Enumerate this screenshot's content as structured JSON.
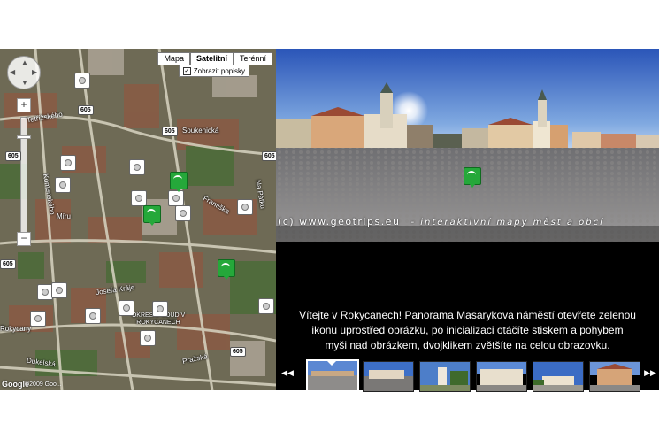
{
  "map": {
    "types": [
      "Mapa",
      "Satelitní",
      "Terénní"
    ],
    "active_type": "Satelitní",
    "labels_checkbox": "Zobrazit popisky",
    "labels_checked": true,
    "roads": [
      "605",
      "605",
      "605",
      "605",
      "605",
      "605"
    ],
    "streets": [
      "Tetřížského",
      "Soukenická",
      "Františka",
      "Míru",
      "Josefa Kráje",
      "Pražská",
      "Dukelská",
      "Na Pátku",
      "Komenského",
      "Rokycany",
      "OKRESNÍ SOUD V ROKYCANECH"
    ],
    "legal": "©2009 Goo...",
    "logo": "Google"
  },
  "pano": {
    "watermark": "(c) www.geotrips.eu",
    "watermark_tagline": "- interaktivní mapy měst a obcí"
  },
  "description": {
    "lines": [
      "Vítejte v Rokycanech! Panorama Masarykova náměstí otevřete zelenou",
      "ikonu uprostřed obrázku, po inicializaci otáčíte stiskem a pohybem",
      "myši nad obrázkem, dvojklikem zvětšíte na celou obrazovku."
    ]
  },
  "strip": {
    "prev": "◀◀",
    "next": "▶▶",
    "thumbnails": [
      "thumb-1",
      "thumb-2",
      "thumb-3",
      "thumb-4",
      "thumb-5",
      "thumb-6"
    ],
    "active_index": 0
  }
}
